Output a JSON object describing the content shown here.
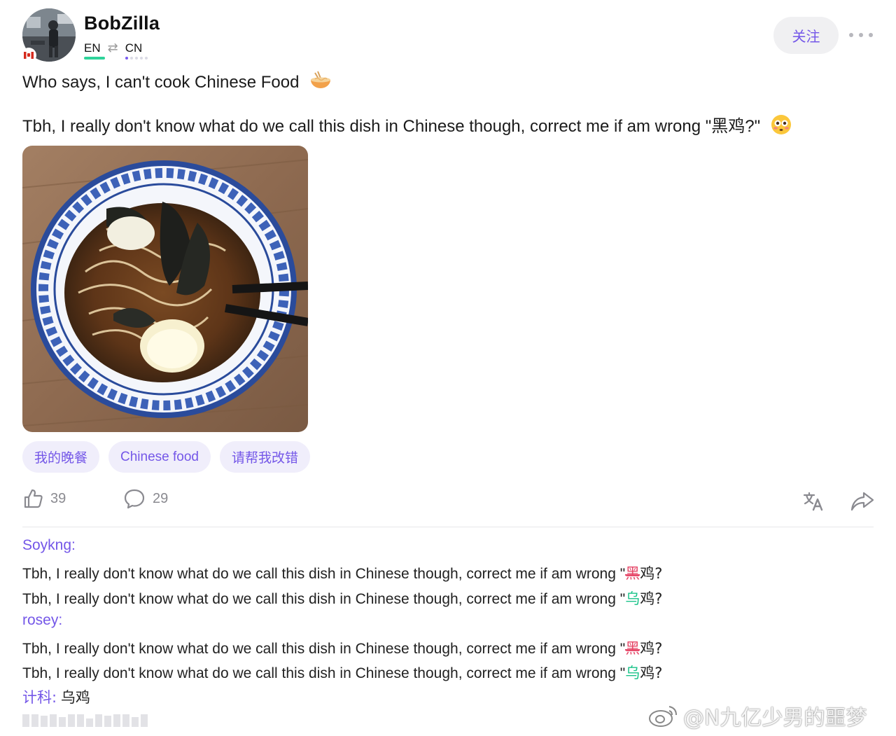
{
  "post": {
    "author": {
      "name": "BobZilla",
      "lang_from": "EN",
      "lang_to": "CN",
      "avatar_icon": "avatar-photo",
      "flag_icon": "canada-flag-icon"
    },
    "follow_label": "关注",
    "text_line1": "Who says, I can't cook Chinese Food",
    "text_line1_emoji": "noodle-bowl-icon",
    "text_line2": "Tbh, I really don't know what do we call this dish in Chinese though, correct me if am wrong \"黑鸡?\"",
    "text_line2_emoji": "flushed-face-icon",
    "image": "noodle-soup-photo",
    "tags": [
      "我的晚餐",
      "Chinese food",
      "请帮我改错"
    ],
    "likes": "39",
    "comments": "29"
  },
  "corrections": [
    {
      "author": "Soykng:",
      "original_prefix": "Tbh, I really don't know what do we call this dish in Chinese though, correct me if am wrong \"",
      "original_wrong": "黑",
      "original_suffix": "鸡?",
      "corrected_prefix": "Tbh, I really don't know what do we call this dish in Chinese though, correct me if am wrong \"",
      "corrected_right": "乌",
      "corrected_suffix": "鸡?"
    },
    {
      "author": "rosey:",
      "original_prefix": "Tbh, I really don't know what do we call this dish in Chinese though, correct me if am wrong \"",
      "original_wrong": "黑",
      "original_suffix": "鸡?",
      "corrected_prefix": "Tbh, I really don't know what do we call this dish in Chinese though, correct me if am wrong \"",
      "corrected_right": "乌",
      "corrected_suffix": "鸡?"
    }
  ],
  "note": {
    "label": "计科:",
    "value": "乌鸡"
  },
  "watermark": "@N九亿少男的噩梦",
  "colors": {
    "accent": "#7457e8",
    "wrong": "#e64567",
    "right": "#1bc38a",
    "en_bar": "#2fd39a"
  }
}
